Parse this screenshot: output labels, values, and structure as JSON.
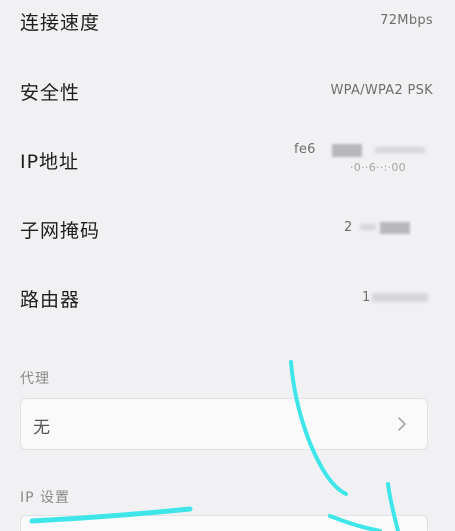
{
  "rows": [
    {
      "label": "连接速度",
      "value": "72Mbps"
    },
    {
      "label": "安全性",
      "value": "WPA/WPA2 PSK"
    },
    {
      "label": "IP地址",
      "value": "fe6",
      "value2": "·0··6··:·00"
    },
    {
      "label": "子网掩码",
      "value": "2"
    },
    {
      "label": "路由器",
      "value": "1"
    }
  ],
  "proxy": {
    "title": "代理",
    "selected": "无"
  },
  "ip_settings": {
    "title": "IP 设置"
  },
  "colors": {
    "background": "#f1f1f3",
    "scribble": "#3fe6e9"
  },
  "icons": {
    "chevron": "chevron-right-icon"
  }
}
